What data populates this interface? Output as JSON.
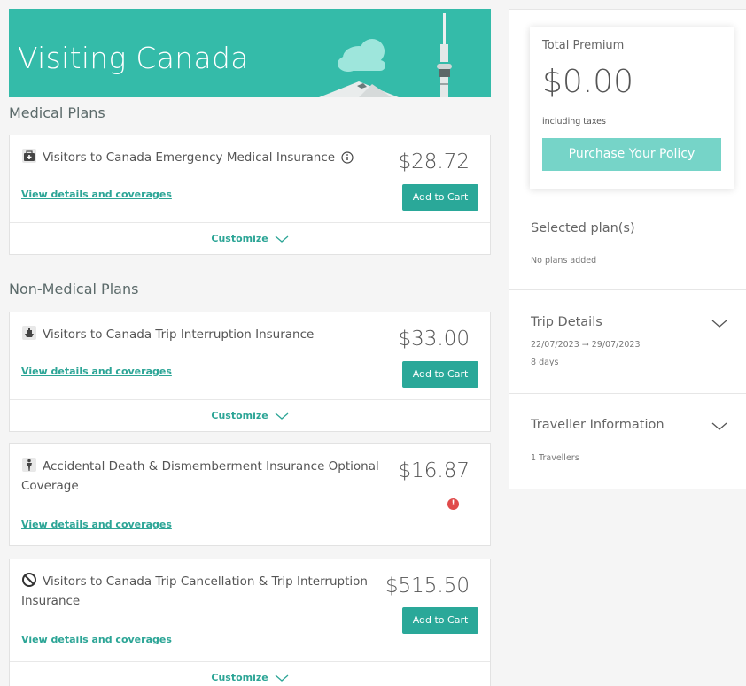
{
  "banner": {
    "title": "Visiting Canada"
  },
  "sections": {
    "medical_title": "Medical Plans",
    "non_medical_title": "Non-Medical Plans"
  },
  "plans": [
    {
      "name": "Visitors to Canada Emergency Medical Insurance",
      "price": "$28.72",
      "link": "View details and coverages",
      "add": "Add to Cart",
      "customize": "Customize",
      "icon": "medical-kit-icon"
    },
    {
      "name": "Visitors to Canada Trip Interruption Insurance",
      "price": "$33.00",
      "link": "View details and coverages",
      "add": "Add to Cart",
      "customize": "Customize",
      "icon": "ship-icon"
    },
    {
      "name_line1": "Accidental Death & Dismemberment Insurance Optional",
      "name_line2": "Coverage",
      "price": "$16.87",
      "link": "View details and coverages",
      "icon": "person-icon",
      "warning": "!"
    },
    {
      "name_line1": "Visitors to Canada Trip Cancellation & Trip Interruption",
      "name_line2": "Insurance",
      "price": "$515.50",
      "link": "View details and coverages",
      "add": "Add to Cart",
      "customize": "Customize",
      "icon": "no-entry-icon"
    }
  ],
  "premium": {
    "label": "Total Premium",
    "amount": "$0.00",
    "sub": "including taxes",
    "button": "Purchase Your Policy"
  },
  "selected": {
    "title": "Selected plan(s)",
    "empty": "No plans added"
  },
  "trip": {
    "title": "Trip Details",
    "dates": "22/07/2023 → 29/07/2023",
    "length": "8 days"
  },
  "traveller": {
    "title": "Traveller Information",
    "count": "1 Travellers"
  },
  "colors": {
    "accent": "#34bba9",
    "button": "#2aa899",
    "purchase": "#76d4c8",
    "warning": "#e04b4b"
  }
}
